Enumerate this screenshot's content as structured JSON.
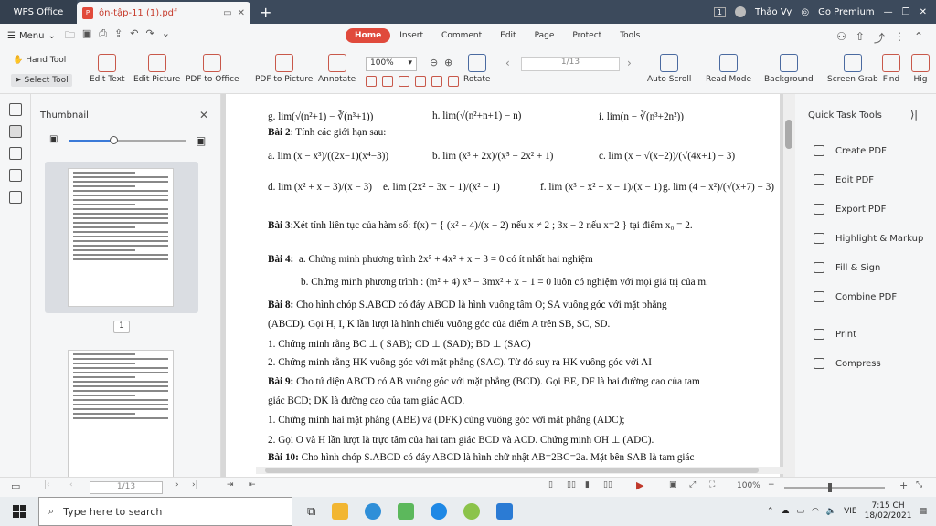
{
  "titlebar": {
    "app": "WPS Office",
    "tab_name": "ôn-tập-11 (1).pdf",
    "badge": "1",
    "user": "Thảo Vy",
    "premium": "Go Premium"
  },
  "menu": {
    "label": "Menu",
    "tabs": [
      "Home",
      "Insert",
      "Comment",
      "Edit",
      "Page",
      "Protect",
      "Tools"
    ]
  },
  "toolbar": {
    "hand": "Hand Tool",
    "select": "Select Tool",
    "tools": [
      "Edit Text",
      "Edit Picture",
      "PDF to Office",
      "PDF to Picture",
      "Annotate",
      "Rotate",
      "Auto Scroll",
      "Read Mode",
      "Background",
      "Screen Grab",
      "Find",
      "Hig"
    ],
    "zoom": "100%",
    "page": "1/13"
  },
  "thumbnail": {
    "title": "Thumbnail",
    "page_num": "1"
  },
  "doc": {
    "l1_g": "g. lim(√(n²+1) − ∛(n³+1))",
    "l1_h": "h. lim(√(n²+n+1) − n)",
    "l1_i": "i. lim(n − ∛(n³+2n²))",
    "bai2": "Bài 2",
    "bai2_text": ": Tính các giới hạn sau:",
    "r1_a": "a. lim (x − x³)/((2x−1)(x⁴−3))",
    "r1_b": "b. lim (x³ + 2x)/(x⁵ − 2x² + 1)",
    "r1_c": "c. lim (x − √(x−2))/(√(4x+1) − 3)",
    "r2_d": "d. lim (x² + x − 3)/(x − 3)",
    "r2_e": "e. lim (2x² + 3x + 1)/(x² − 1)",
    "r2_f": "f. lim (x³ − x² + x − 1)/(x − 1)",
    "r2_g": "g. lim (4 − x²)/(√(x+7) − 3)",
    "bai3": "Bài 3",
    "bai3_text": ":Xét tính liên tục của hàm số: f(x) = { (x² − 4)/(x − 2) nếu x ≠ 2 ; 3x − 2 nếu x=2 } tại điểm x₀ = 2.",
    "bai4": "Bài 4:",
    "bai4_a": "a. Chứng minh phương trình 2x⁵ + 4x² + x − 3 = 0 có ít nhất hai nghiệm",
    "bai4_b": "b. Chứng minh phương trình : (m² + 4) x⁵ − 3mx² + x − 1 = 0 luôn có nghiệm với mọi giá trị của m.",
    "bai8": "Bài 8:",
    "bai8_text": " Cho hình chóp S.ABCD có đáy ABCD là hình vuông tâm O; SA vuông góc với mặt phẳng",
    "bai8_l2": "(ABCD). Gọi H, I, K lần lượt là hình chiếu vuông góc của điểm A trên SB, SC, SD.",
    "bai8_q1": "1. Chứng minh rằng BC ⊥ ( SAB); CD ⊥ (SAD); BD ⊥ (SAC)",
    "bai8_q2": "2. Chứng minh rằng HK vuông góc với mặt phẳng (SAC). Từ đó suy ra HK vuông góc với AI",
    "bai9": "Bài 9:",
    "bai9_text": " Cho tứ diện ABCD có AB vuông góc với mặt phẳng (BCD). Gọi BE, DF là hai đường cao của tam",
    "bai9_l2": "giác BCD; DK là đường cao của tam giác ACD.",
    "bai9_q1": "1.   Chứng minh hai mặt phẳng (ABE) và (DFK) cùng vuông góc với mặt phẳng (ADC);",
    "bai9_q2": "2.   Gọi O và H lần lượt là trực tâm của hai tam giác BCD và ACD. Chứng minh OH ⊥ (ADC).",
    "bai10": "Bài 10:",
    "bai10_text": "  Cho hình chóp S.ABCD có đáy ABCD là hình chữ nhật AB=2BC=2a. Mặt bên SAB là tam giác"
  },
  "quick": {
    "title": "Quick Task Tools",
    "items": [
      "Create PDF",
      "Edit PDF",
      "Export PDF",
      "Highlight & Markup",
      "Fill & Sign",
      "Combine PDF",
      "Print",
      "Compress"
    ]
  },
  "status": {
    "page": "1/13",
    "zoom": "100%"
  },
  "taskbar": {
    "search": "Type here to search",
    "lang": "VIE",
    "time": "7:15 CH",
    "date": "18/02/2021"
  }
}
